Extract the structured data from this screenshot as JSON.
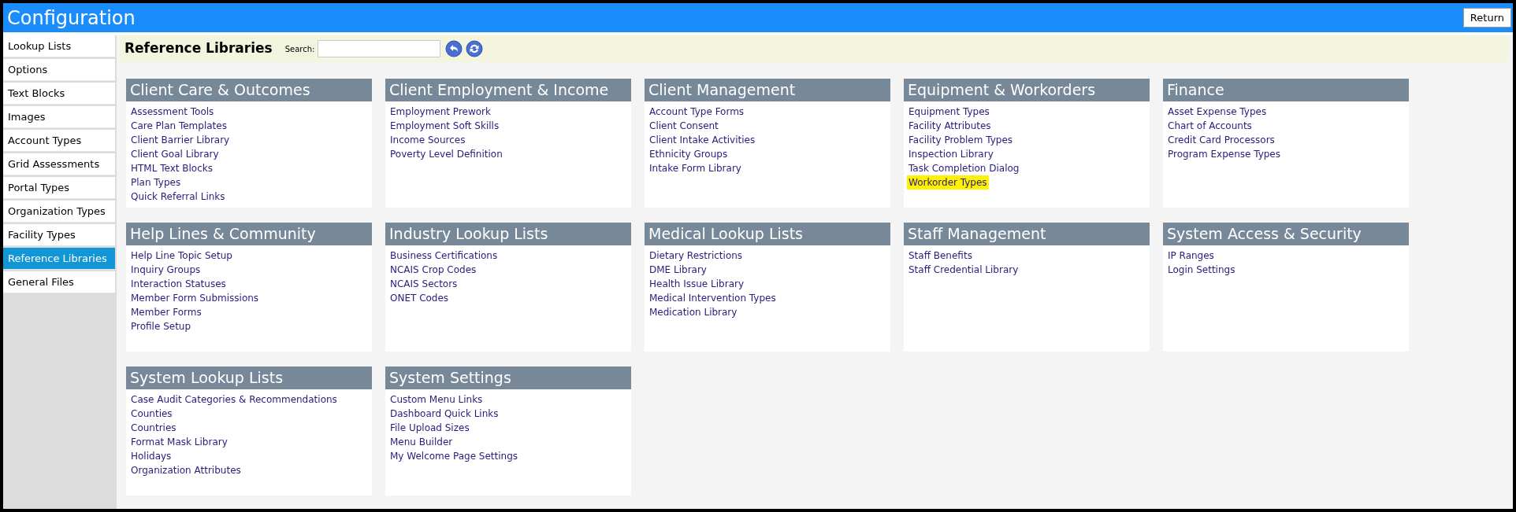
{
  "window": {
    "title": "Configuration",
    "return_button": "Return"
  },
  "sidebar": {
    "items": [
      {
        "label": "Lookup Lists",
        "selected": false
      },
      {
        "label": "Options",
        "selected": false
      },
      {
        "label": "Text Blocks",
        "selected": false
      },
      {
        "label": "Images",
        "selected": false
      },
      {
        "label": "Account Types",
        "selected": false
      },
      {
        "label": "Grid Assessments",
        "selected": false
      },
      {
        "label": "Portal Types",
        "selected": false
      },
      {
        "label": "Organization Types",
        "selected": false
      },
      {
        "label": "Facility Types",
        "selected": false
      },
      {
        "label": "Reference Libraries",
        "selected": true
      },
      {
        "label": "General Files",
        "selected": false
      }
    ]
  },
  "toolbar": {
    "title": "Reference Libraries",
    "search_label": "Search:"
  },
  "sections": [
    {
      "title": "Client Care & Outcomes",
      "links": [
        {
          "label": "Assessment Tools",
          "highlighted": false
        },
        {
          "label": "Care Plan Templates",
          "highlighted": false
        },
        {
          "label": "Client Barrier Library",
          "highlighted": false
        },
        {
          "label": "Client Goal Library",
          "highlighted": false
        },
        {
          "label": "HTML Text Blocks",
          "highlighted": false
        },
        {
          "label": "Plan Types",
          "highlighted": false
        },
        {
          "label": "Quick Referral Links",
          "highlighted": false
        }
      ]
    },
    {
      "title": "Client Employment & Income",
      "links": [
        {
          "label": "Employment Prework",
          "highlighted": false
        },
        {
          "label": "Employment Soft Skills",
          "highlighted": false
        },
        {
          "label": "Income Sources",
          "highlighted": false
        },
        {
          "label": "Poverty Level Definition",
          "highlighted": false
        }
      ]
    },
    {
      "title": "Client Management",
      "links": [
        {
          "label": "Account Type Forms",
          "highlighted": false
        },
        {
          "label": "Client Consent",
          "highlighted": false
        },
        {
          "label": "Client Intake Activities",
          "highlighted": false
        },
        {
          "label": "Ethnicity Groups",
          "highlighted": false
        },
        {
          "label": "Intake Form Library",
          "highlighted": false
        }
      ]
    },
    {
      "title": "Equipment & Workorders",
      "links": [
        {
          "label": "Equipment Types",
          "highlighted": false
        },
        {
          "label": "Facility Attributes",
          "highlighted": false
        },
        {
          "label": "Facility Problem Types",
          "highlighted": false
        },
        {
          "label": "Inspection Library",
          "highlighted": false
        },
        {
          "label": "Task Completion Dialog",
          "highlighted": false
        },
        {
          "label": "Workorder Types",
          "highlighted": true
        }
      ]
    },
    {
      "title": "Finance",
      "links": [
        {
          "label": "Asset Expense Types",
          "highlighted": false
        },
        {
          "label": "Chart of Accounts",
          "highlighted": false
        },
        {
          "label": "Credit Card Processors",
          "highlighted": false
        },
        {
          "label": "Program Expense Types",
          "highlighted": false
        }
      ]
    },
    {
      "title": "Help Lines & Community",
      "links": [
        {
          "label": "Help Line Topic Setup",
          "highlighted": false
        },
        {
          "label": "Inquiry Groups",
          "highlighted": false
        },
        {
          "label": "Interaction Statuses",
          "highlighted": false
        },
        {
          "label": "Member Form Submissions",
          "highlighted": false
        },
        {
          "label": "Member Forms",
          "highlighted": false
        },
        {
          "label": "Profile Setup",
          "highlighted": false
        }
      ]
    },
    {
      "title": "Industry Lookup Lists",
      "links": [
        {
          "label": "Business Certifications",
          "highlighted": false
        },
        {
          "label": "NCAIS Crop Codes",
          "highlighted": false
        },
        {
          "label": "NCAIS Sectors",
          "highlighted": false
        },
        {
          "label": "ONET Codes",
          "highlighted": false
        }
      ]
    },
    {
      "title": "Medical Lookup Lists",
      "links": [
        {
          "label": "Dietary Restrictions",
          "highlighted": false
        },
        {
          "label": "DME Library",
          "highlighted": false
        },
        {
          "label": "Health Issue Library",
          "highlighted": false
        },
        {
          "label": "Medical Intervention Types",
          "highlighted": false
        },
        {
          "label": "Medication Library",
          "highlighted": false
        }
      ]
    },
    {
      "title": "Staff Management",
      "links": [
        {
          "label": "Staff Benefits",
          "highlighted": false
        },
        {
          "label": "Staff Credential Library",
          "highlighted": false
        }
      ]
    },
    {
      "title": "System Access & Security",
      "links": [
        {
          "label": "IP Ranges",
          "highlighted": false
        },
        {
          "label": "Login Settings",
          "highlighted": false
        }
      ]
    },
    {
      "title": "System Lookup Lists",
      "links": [
        {
          "label": "Case Audit Categories & Recommendations",
          "highlighted": false
        },
        {
          "label": "Counties",
          "highlighted": false
        },
        {
          "label": "Countries",
          "highlighted": false
        },
        {
          "label": "Format Mask Library",
          "highlighted": false
        },
        {
          "label": "Holidays",
          "highlighted": false
        },
        {
          "label": "Organization Attributes",
          "highlighted": false
        }
      ]
    },
    {
      "title": "System Settings",
      "links": [
        {
          "label": "Custom Menu Links",
          "highlighted": false
        },
        {
          "label": "Dashboard Quick Links",
          "highlighted": false
        },
        {
          "label": "File Upload Sizes",
          "highlighted": false
        },
        {
          "label": "Menu Builder",
          "highlighted": false
        },
        {
          "label": "My Welcome Page Settings",
          "highlighted": false
        }
      ]
    }
  ]
}
